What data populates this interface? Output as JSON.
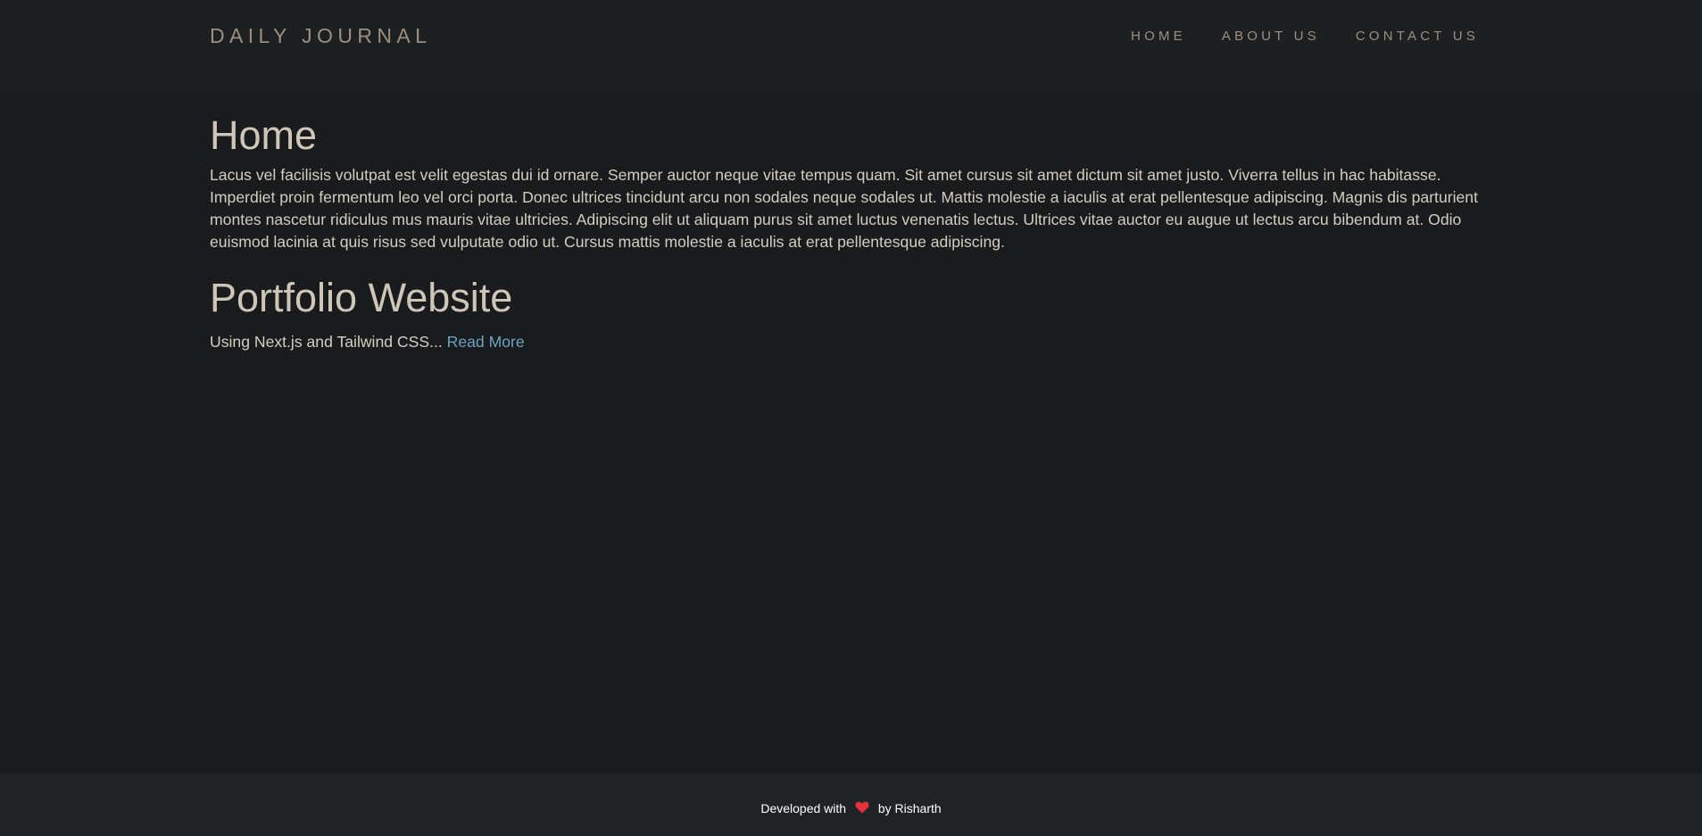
{
  "navbar": {
    "brand": "DAILY JOURNAL",
    "links": [
      {
        "label": "HOME"
      },
      {
        "label": "ABOUT US"
      },
      {
        "label": "CONTACT US"
      }
    ]
  },
  "home": {
    "title": "Home",
    "body": "Lacus vel facilisis volutpat est velit egestas dui id ornare. Semper auctor neque vitae tempus quam. Sit amet cursus sit amet dictum sit amet justo. Viverra tellus in hac habitasse. Imperdiet proin fermentum leo vel orci porta. Donec ultrices tincidunt arcu non sodales neque sodales ut. Mattis molestie a iaculis at erat pellentesque adipiscing. Magnis dis parturient montes nascetur ridiculus mus mauris vitae ultricies. Adipiscing elit ut aliquam purus sit amet luctus venenatis lectus. Ultrices vitae auctor eu augue ut lectus arcu bibendum at. Odio euismod lacinia at quis risus sed vulputate odio ut. Cursus mattis molestie a iaculis at erat pellentesque adipiscing."
  },
  "posts": [
    {
      "title": "Portfolio Website",
      "excerpt": "Using Next.js and Tailwind CSS...",
      "read_more": "Read More"
    }
  ],
  "footer": {
    "prefix": "Developed with",
    "icon": "heart-icon",
    "suffix": "by Risharth"
  },
  "colors": {
    "background": "#191b1d",
    "navbar": "#1d1f21",
    "footer": "#1f2326",
    "nav_text": "#9a9082",
    "link": "#6ba3c6",
    "heart": "#e5323a"
  }
}
